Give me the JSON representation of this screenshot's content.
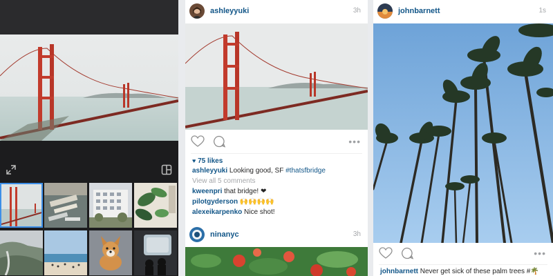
{
  "editor": {
    "expand_icon": "expand-icon",
    "layout_icon": "layout-icon",
    "thumbnails": [
      "golden-gate-thumb",
      "harbor-thumb",
      "building-thumb",
      "plants-thumb",
      "coast-thumb",
      "beach-thumb",
      "dog-thumb",
      "window-thumb"
    ]
  },
  "posts": [
    {
      "username": "ashleyyuki",
      "time": "3h",
      "likes": "75 likes",
      "caption_user": "ashleyyuki",
      "caption_text": " Looking good, SF ",
      "caption_tag": "#thatsfbridge",
      "view_comments": "View all 5 comments",
      "comments": [
        {
          "user": "kweenpri",
          "text": " that bridge! ❤"
        },
        {
          "user": "pilotgyderson",
          "text": " 🙌🙌🙌🙌"
        },
        {
          "user": "alexeikarpenko",
          "text": " Nice shot!"
        }
      ]
    },
    {
      "username": "ninanyc",
      "time": "3h"
    },
    {
      "username": "johnbarnett",
      "time": "1s",
      "caption_user": "johnbarnett",
      "caption_text": " Never get sick of these palm trees #🌴"
    }
  ],
  "icons": {
    "like": "heart-outline-icon",
    "comment": "comment-bubble-icon",
    "more": "more-options-icon"
  },
  "colors": {
    "link": "#125688",
    "muted": "#a5a7aa",
    "dark_bg": "#1c1c1e",
    "heart": "#ed4956"
  }
}
